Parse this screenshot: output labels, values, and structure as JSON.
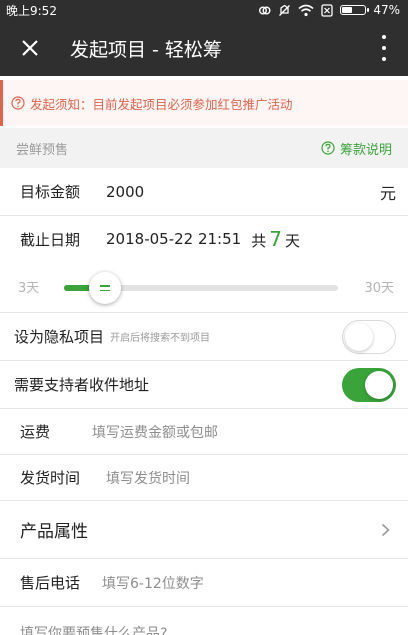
{
  "status_bar": {
    "time": "晚上9:52",
    "battery": "47%",
    "battery_level": 0.47
  },
  "app_bar": {
    "title": "发起项目 - 轻松筹"
  },
  "notice": {
    "text": "发起须知：目前发起项目必须参加红包推广活动"
  },
  "section": {
    "title": "尝鲜预售",
    "help_label": "筹款说明"
  },
  "form": {
    "target_amount": {
      "label": "目标金额",
      "value": "2000",
      "unit": "元"
    },
    "deadline": {
      "label": "截止日期",
      "date": "2018-05-22 21:51",
      "prefix": "共",
      "days": "7",
      "suffix": "天"
    },
    "slider": {
      "min_label": "3天",
      "max_label": "30天",
      "min": 3,
      "max": 30,
      "value": 7
    },
    "privacy": {
      "label": "设为隐私项目",
      "hint": "开启后将搜索不到项目",
      "enabled": false
    },
    "address": {
      "label": "需要支持者收件地址",
      "enabled": true
    },
    "shipping_fee": {
      "label": "运费",
      "placeholder": "填写运费金额或包邮"
    },
    "ship_time": {
      "label": "发货时间",
      "placeholder": "填写发货时间"
    },
    "product_attr": {
      "label": "产品属性"
    },
    "after_sale": {
      "label": "售后电话",
      "placeholder": "填写6-12位数字"
    },
    "description": {
      "placeholder": "填写你要预售什么产品?"
    }
  },
  "colors": {
    "accent": "#3aa33a",
    "warning": "#e0644d",
    "bar": "#2f2f2f"
  },
  "icons": [
    "close-icon",
    "more-vert-icon",
    "question-circle-icon",
    "chevron-right-icon",
    "wifi-icon",
    "battery-icon"
  ]
}
